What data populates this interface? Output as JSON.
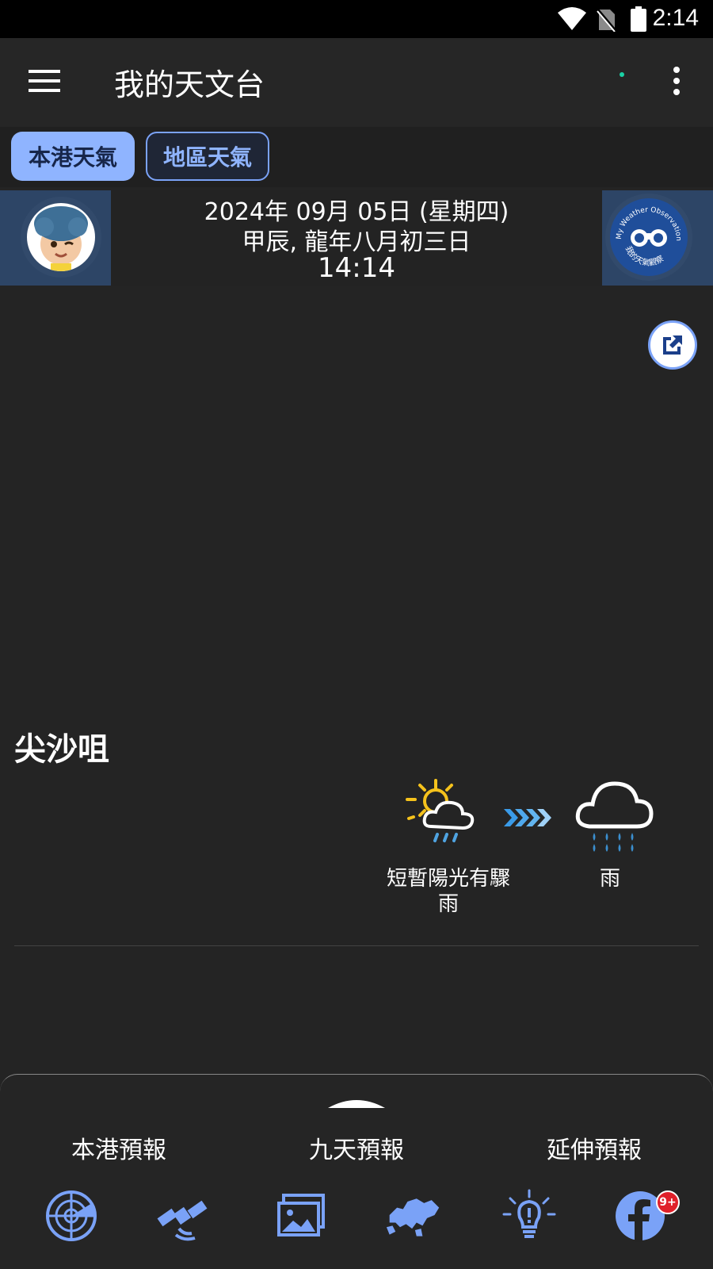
{
  "status_bar": {
    "time": "2:14"
  },
  "app_bar": {
    "title": "我的天文台"
  },
  "tabs": [
    {
      "label": "本港天氣",
      "active": true
    },
    {
      "label": "地區天氣",
      "active": false
    }
  ],
  "date_banner": {
    "gregorian": "2024年 09月 05日 (星期四)",
    "lunar": "甲辰, 龍年八月初三日",
    "time": "14:14",
    "badge_text_top": "My Weather Observation",
    "badge_text_bottom": "我的天氣觀察"
  },
  "location": "尖沙咀",
  "forecast": {
    "now": {
      "label": "短暫陽光有驟雨",
      "icon": "sun-cloud-rain-icon"
    },
    "next": {
      "label": "雨",
      "icon": "rain-cloud-icon"
    }
  },
  "bottom_sheet": {
    "links": [
      "本港預報",
      "九天預報",
      "延伸預報"
    ],
    "icons": [
      "radar-icon",
      "satellite-icon",
      "gallery-icon",
      "hk-map-icon",
      "tips-bulb-icon",
      "facebook-icon"
    ],
    "facebook_badge": "9+"
  },
  "colors": {
    "accent": "#8fb4ff",
    "background": "#242424",
    "banner_edge": "#2d4566"
  }
}
